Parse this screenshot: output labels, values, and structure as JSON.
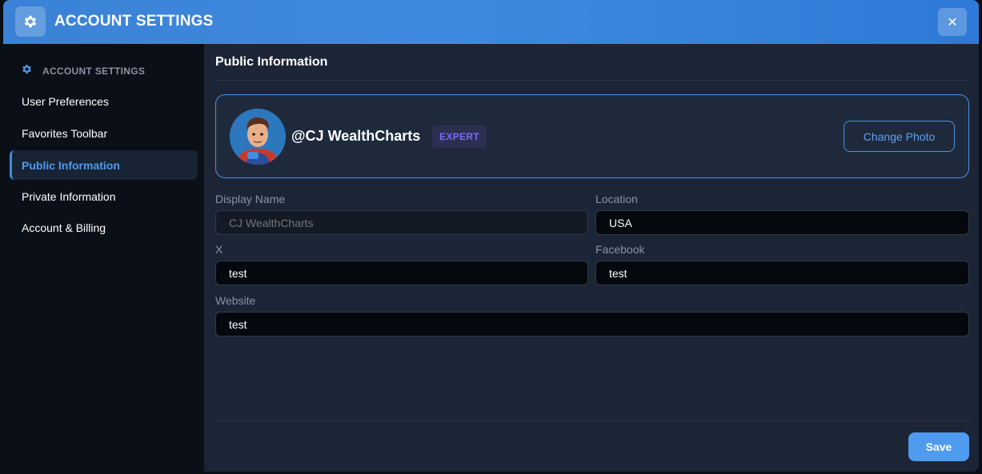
{
  "header": {
    "title": "ACCOUNT SETTINGS",
    "icon": "gear-icon",
    "close_icon": "✕"
  },
  "sidebar": {
    "section_label": "ACCOUNT SETTINGS",
    "items": [
      {
        "label": "User Preferences"
      },
      {
        "label": "Favorites Toolbar"
      },
      {
        "label": "Public Information",
        "active": true
      },
      {
        "label": "Private Information"
      },
      {
        "label": "Account & Billing"
      }
    ]
  },
  "main": {
    "title": "Public Information",
    "profile": {
      "username": "@CJ WealthCharts",
      "badge": "EXPERT",
      "change_photo_label": "Change Photo"
    },
    "fields": {
      "display_name": {
        "label": "Display Name",
        "placeholder": "CJ WealthCharts",
        "value": ""
      },
      "location": {
        "label": "Location",
        "value": "USA"
      },
      "x": {
        "label": "X",
        "value": "test"
      },
      "facebook": {
        "label": "Facebook",
        "value": "test"
      },
      "website": {
        "label": "Website",
        "value": "test"
      }
    },
    "save_label": "Save"
  },
  "colors": {
    "accent": "#4f9bf0",
    "header_bg": "#3f8ae0",
    "badge_text": "#7a6cf0",
    "panel_bg": "#1c2535",
    "sidebar_bg": "#0b0f17"
  }
}
